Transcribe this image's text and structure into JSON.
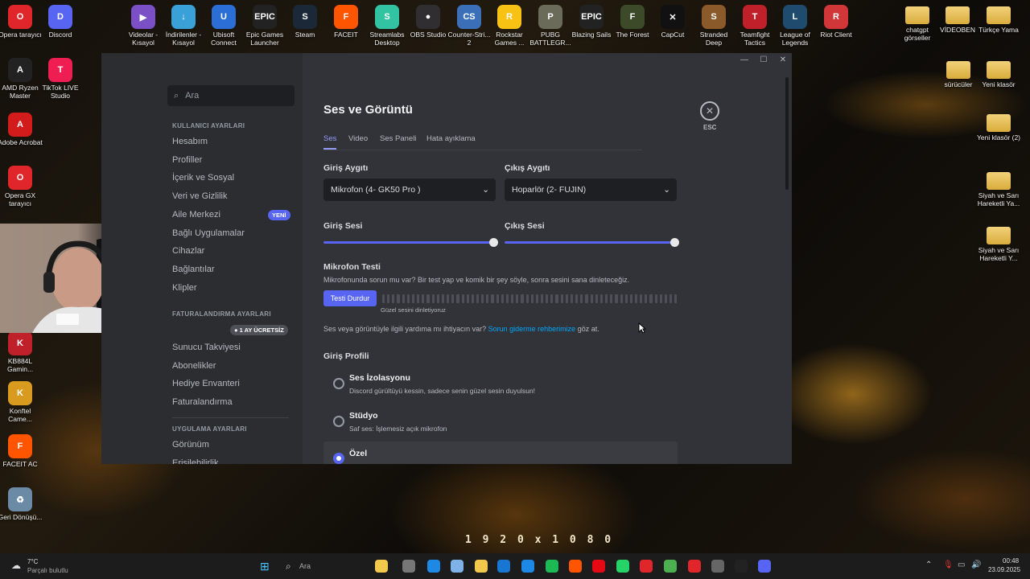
{
  "desktop": {
    "left_icons": [
      {
        "label": "Opera tarayıcı",
        "color": "#e0262b",
        "glyph": "O"
      },
      {
        "label": "Discord",
        "color": "#5865f2",
        "glyph": "D"
      },
      {
        "label": "AMD Ryzen Master",
        "color": "#222",
        "glyph": "A"
      },
      {
        "label": "TikTok LIVE Studio",
        "color": "#ee1d52",
        "glyph": "T"
      },
      {
        "label": "Adobe Acrobat",
        "color": "#d21c1c",
        "glyph": "A"
      },
      {
        "label": "Opera GX tarayıcı",
        "color": "#e0262b",
        "glyph": "O"
      },
      {
        "label": "KB884L Gamin...",
        "color": "#c0202a",
        "glyph": "K"
      },
      {
        "label": "Konftel Came...",
        "color": "#d99a20",
        "glyph": "K"
      },
      {
        "label": "FACEIT AC",
        "color": "#ff5500",
        "glyph": "F"
      },
      {
        "label": "Geri Dönüşü...",
        "color": "#6b8aa6",
        "glyph": "♻"
      }
    ],
    "top_icons": [
      {
        "label": "Videolar - Kısayol",
        "color": "#7b4fc6",
        "glyph": "▶"
      },
      {
        "label": "İndirilenler - Kısayol",
        "color": "#3aa0d8",
        "glyph": "↓"
      },
      {
        "label": "Ubisoft Connect",
        "color": "#2b6fd6",
        "glyph": "U"
      },
      {
        "label": "Epic Games Launcher",
        "color": "#222",
        "glyph": "EPIC"
      },
      {
        "label": "Steam",
        "color": "#1b2838",
        "glyph": "S"
      },
      {
        "label": "FACEIT",
        "color": "#ff5500",
        "glyph": "F"
      },
      {
        "label": "Streamlabs Desktop",
        "color": "#31c3a2",
        "glyph": "S"
      },
      {
        "label": "OBS Studio",
        "color": "#302e31",
        "glyph": "●"
      },
      {
        "label": "Counter-Stri... 2",
        "color": "#3b70b8",
        "glyph": "CS"
      },
      {
        "label": "Rockstar Games ...",
        "color": "#f7c214",
        "glyph": "R"
      },
      {
        "label": "PUBG BATTLEGR...",
        "color": "#6b6b5a",
        "glyph": "P"
      },
      {
        "label": "Blazing Sails",
        "color": "#222",
        "glyph": "EPIC"
      },
      {
        "label": "The Forest",
        "color": "#3c4a2a",
        "glyph": "F"
      },
      {
        "label": "CapCut",
        "color": "#111",
        "glyph": "✕"
      },
      {
        "label": "Stranded Deep",
        "color": "#8a5a2a",
        "glyph": "S"
      },
      {
        "label": "Teamfight Tactics",
        "color": "#c0202a",
        "glyph": "T"
      },
      {
        "label": "League of Legends",
        "color": "#1e4b6e",
        "glyph": "L"
      },
      {
        "label": "Riot Client",
        "color": "#d13639",
        "glyph": "R"
      }
    ],
    "right_icons": [
      {
        "label": "chatgpt görseller"
      },
      {
        "label": "VİDEOBEN"
      },
      {
        "label": "Türkçe Yama"
      },
      {
        "label": "sürücüler"
      },
      {
        "label": "Yeni klasör"
      },
      {
        "label": "Yeni klasör (2)"
      },
      {
        "label": "Siyah ve Sarı Hareketli Ya..."
      },
      {
        "label": "Siyah ve Sarı Hareketli Y..."
      }
    ],
    "watermark": "1 9 2 0 x 1 0 8 0"
  },
  "window": {
    "search_placeholder": "Ara",
    "controls": {
      "minimize": "—",
      "maximize": "☐",
      "close": "✕"
    },
    "sidebar": {
      "section_user": "KULLANICI AYARLARI",
      "items_user": [
        "Hesabım",
        "Profiller",
        "İçerik ve Sosyal",
        "Veri ve Gizlilik",
        "Aile Merkezi",
        "Bağlı Uygulamalar",
        "Cihazlar",
        "Bağlantılar",
        "Klipler"
      ],
      "new_badge": "YENİ",
      "section_billing": "FATURALANDIRMA AYARLARI",
      "nitro_badge": "1 AY ÜCRETSİZ",
      "items_billing": [
        "Sunucu Takviyesi",
        "Abonelikler",
        "Hediye Envanteri",
        "Faturalandırma"
      ],
      "section_app": "UYGULAMA AYARLARI",
      "items_app": [
        "Görünüm",
        "Erişilebilirlik"
      ]
    },
    "main": {
      "title": "Ses ve Görüntü",
      "tabs": [
        "Ses",
        "Video",
        "Ses Paneli",
        "Hata ayıklama"
      ],
      "input_device_label": "Giriş Aygıtı",
      "input_device_value": "Mikrofon (4- GK50 Pro )",
      "output_device_label": "Çıkış Aygıtı",
      "output_device_value": "Hoparlör (2- FUJIN)",
      "input_volume_label": "Giriş Sesi",
      "input_volume": 1.0,
      "output_volume_label": "Çıkış Sesi",
      "output_volume": 1.0,
      "mic_test_title": "Mikrofon Testi",
      "mic_test_desc": "Mikrofonunda sorun mu var? Bir test yap ve komik bir şey söyle, sonra sesini sana dinleteceğiz.",
      "mic_test_button": "Testi Durdur",
      "mic_test_status": "Güzel sesini dinletiyoruz",
      "help_text_prefix": "Ses veya görüntüyle ilgili yardıma mı ihtiyacın var?",
      "help_link": "Sorun giderme rehberimize",
      "help_text_suffix": "göz at.",
      "input_profile_title": "Giriş Profili",
      "profiles": [
        {
          "title": "Ses İzolasyonu",
          "desc": "Discord gürültüyü kessin, sadece senin güzel sesin duyulsun!",
          "selected": false
        },
        {
          "title": "Stüdyo",
          "desc": "Saf ses: İşlemesiz açık mikrofon",
          "selected": false
        },
        {
          "title": "Özel",
          "desc": "",
          "selected": true
        }
      ],
      "esc_label": "ESC"
    }
  },
  "taskbar": {
    "weather_temp": "7°C",
    "weather_desc": "Parçalı bulutlu",
    "search_placeholder": "Ara",
    "time": "00:48",
    "date": "23.09.2025"
  }
}
